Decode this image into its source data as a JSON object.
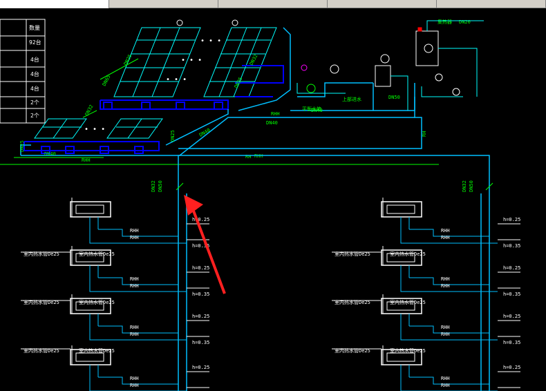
{
  "tabs": [
    {
      "label": ""
    },
    {
      "label": ""
    },
    {
      "label": ""
    },
    {
      "label": ""
    },
    {
      "label": ""
    },
    {
      "label": ""
    }
  ],
  "legend_table": {
    "header": "数量",
    "counts": [
      "92台",
      "4台",
      "4台",
      "4台",
      "2个",
      "2个"
    ]
  },
  "pipe_labels": {
    "dn65": "DN65",
    "dn50": "DN50",
    "dn40": "DN40",
    "dn32": "DN32",
    "dn25": "DN25",
    "dn20": "DN20",
    "dn15": "DN15",
    "rh": "RH",
    "rhh": "RHH",
    "h025": "h=0.25",
    "h035": "h=0.35",
    "room": "室内热水管De25",
    "balance": "平衡水箱",
    "supply": "上部进水",
    "heater": "集热器"
  },
  "colors": {
    "pipe": "#00bfff",
    "green": "#00ff00",
    "white": "#ffffff",
    "red": "#ff0000",
    "blue": "#0000ff",
    "magenta": "#ff00ff",
    "yellow": "#ffff00"
  }
}
